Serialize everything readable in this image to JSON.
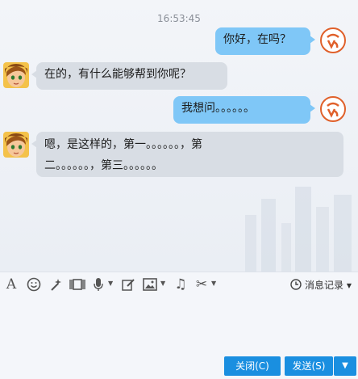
{
  "chat": {
    "timestamp": "16:53:45",
    "messages": [
      {
        "side": "out",
        "text": "你好，在吗？"
      },
      {
        "side": "in",
        "text": "在的，有什么能够帮到你呢？"
      },
      {
        "side": "out",
        "text": "我想问。。。。。。"
      },
      {
        "side": "in",
        "text_line1": "嗯，是这样的，第一。。。。。。，第",
        "text_line2": "二。。。。。。，第三。。。。。。"
      }
    ]
  },
  "toolbar": {
    "icons": [
      "font-icon",
      "emoji-icon",
      "magic-icon",
      "video-icon",
      "mic-icon",
      "edit-icon",
      "image-icon",
      "music-icon",
      "scissors-icon",
      "clock-icon"
    ],
    "history_label": "消息记录"
  },
  "buttons": {
    "close_label": "关闭(C)",
    "send_label": "发送(S)"
  },
  "colors": {
    "outgoing_bubble": "#7fc7f7",
    "incoming_bubble": "#d8dde4",
    "primary_button": "#1a8fe0"
  }
}
